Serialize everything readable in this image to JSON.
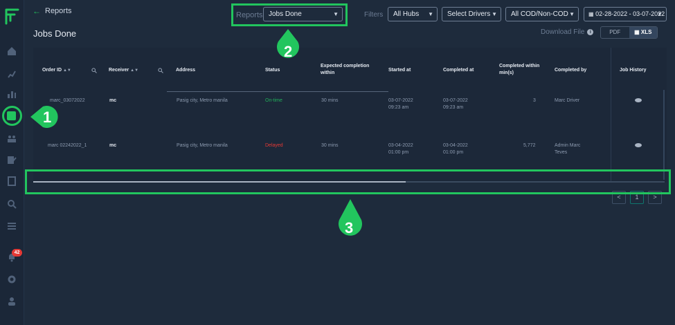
{
  "header": {
    "back_label": "Reports",
    "page_title": "Jobs Done"
  },
  "reports_select": {
    "label": "Reports",
    "value": "Jobs Done"
  },
  "filters": {
    "label": "Filters",
    "hubs": "All Hubs",
    "drivers": "Select Drivers",
    "cod": "All COD/Non-COD",
    "date_range": "02-28-2022 - 03-07-2022"
  },
  "download": {
    "label": "Download File",
    "pdf": "PDF",
    "xls": "XLS"
  },
  "sidebar": {
    "notification_count": "42"
  },
  "table": {
    "columns": [
      "Order ID",
      "Receiver",
      "Address",
      "Status",
      "Expected completion within",
      "Started at",
      "Completed at",
      "Completed within min(s)",
      "Completed by",
      "Job History"
    ],
    "rows": [
      {
        "order_id": "marc_03072022",
        "receiver": "mc",
        "address": "Pasig city, Metro manila",
        "status": "On-time",
        "expected": "30 mins",
        "started_date": "03-07-2022",
        "started_time": "09:23 am",
        "completed_date": "03-07-2022",
        "completed_time": "09:23 am",
        "within": "3",
        "completed_by": "Marc Driver",
        "completed_by_2": ""
      },
      {
        "order_id": "marc 02242022_1",
        "receiver": "mc",
        "address": "Pasig city, Metro manila",
        "status": "Delayed",
        "expected": "30 mins",
        "started_date": "03-04-2022",
        "started_time": "01:00 pm",
        "completed_date": "03-04-2022",
        "completed_time": "01:00 pm",
        "within": "5,772",
        "completed_by": "Admin Marc",
        "completed_by_2": "Teves"
      }
    ]
  },
  "pagination": {
    "prev": "<",
    "current": "1",
    "next": ">"
  },
  "annotations": [
    "1",
    "2",
    "3"
  ],
  "colors": {
    "accent": "#22c55e",
    "background": "#1e2b3c",
    "status_ontime": "#21b15a",
    "status_delayed": "#e53935"
  }
}
